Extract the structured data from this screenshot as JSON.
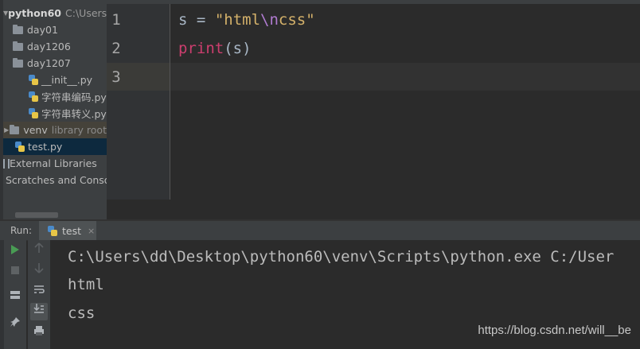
{
  "project_tree": {
    "root": {
      "name": "python60",
      "path": "C:\\Users\\"
    },
    "items": [
      {
        "label": "day01",
        "icon": "folder-icon"
      },
      {
        "label": "day1206",
        "icon": "folder-icon"
      },
      {
        "label": "day1207",
        "icon": "folder-icon"
      },
      {
        "label": "__init__.py",
        "icon": "python-file-icon"
      },
      {
        "label": "字符串编码.py",
        "icon": "python-file-icon"
      },
      {
        "label": "字符串转义.py",
        "icon": "python-file-icon"
      },
      {
        "label": "venv",
        "note": "library root",
        "icon": "folder-icon"
      },
      {
        "label": "test.py",
        "icon": "python-file-icon"
      },
      {
        "label": "External Libraries",
        "icon": "library-icon"
      },
      {
        "label": "Scratches and Consoles",
        "icon": "scratch-icon"
      }
    ]
  },
  "editor": {
    "line_numbers": [
      "1",
      "2",
      "3"
    ],
    "lines": [
      {
        "var": "s",
        "op": "=",
        "str_open": "\"html",
        "escape": "\\n",
        "str_close": "css\""
      },
      {
        "fn": "print",
        "args": "(s)"
      },
      {
        "text": ""
      }
    ],
    "current_line": 3
  },
  "run_panel": {
    "label": "Run:",
    "tab_label": "test",
    "close_glyph": "×",
    "console_lines": [
      "C:\\Users\\dd\\Desktop\\python60\\venv\\Scripts\\python.exe C:/User",
      "html",
      "css"
    ]
  },
  "watermark": "https://blog.csdn.net/will__be",
  "colors": {
    "accent_run": "#499c54",
    "string": "#d4b16a",
    "escape": "#b07bd0",
    "builtin": "#cc3e6e"
  }
}
